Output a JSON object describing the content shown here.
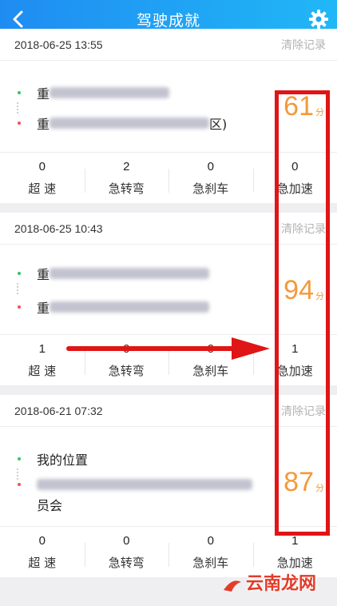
{
  "header": {
    "title": "驾驶成就",
    "back_icon": "chevron-left-icon",
    "settings_icon": "gear-icon"
  },
  "trips": [
    {
      "date": "2018-06-25 13:55",
      "clear_label": "清除记录",
      "start": {
        "prefix": "重",
        "suffix": ""
      },
      "end": {
        "prefix": "重",
        "suffix": "区)"
      },
      "score": "61",
      "score_unit": "分",
      "stats": [
        {
          "value": "0",
          "label": "超 速"
        },
        {
          "value": "2",
          "label": "急转弯"
        },
        {
          "value": "0",
          "label": "急刹车"
        },
        {
          "value": "0",
          "label": "急加速"
        }
      ]
    },
    {
      "date": "2018-06-25 10:43",
      "clear_label": "清除记录",
      "start": {
        "prefix": "重",
        "suffix": ""
      },
      "end": {
        "prefix": "重",
        "suffix": ""
      },
      "score": "94",
      "score_unit": "分",
      "stats": [
        {
          "value": "1",
          "label": "超 速"
        },
        {
          "value": "0",
          "label": "急转弯"
        },
        {
          "value": "0",
          "label": "急刹车"
        },
        {
          "value": "1",
          "label": "急加速"
        }
      ]
    },
    {
      "date": "2018-06-21 07:32",
      "clear_label": "清除记录",
      "start": {
        "prefix": "我的位置",
        "suffix": ""
      },
      "end": {
        "prefix": "",
        "suffix": "员会"
      },
      "score": "87",
      "score_unit": "分",
      "stats": [
        {
          "value": "0",
          "label": "超 速"
        },
        {
          "value": "0",
          "label": "急转弯"
        },
        {
          "value": "0",
          "label": "急刹车"
        },
        {
          "value": "1",
          "label": "急加速"
        }
      ]
    }
  ],
  "watermark": "云南龙网",
  "colors": {
    "header_start": "#1f8cf2",
    "header_end": "#21b7f6",
    "score": "#f39a3a",
    "annotation": "#e01515"
  }
}
